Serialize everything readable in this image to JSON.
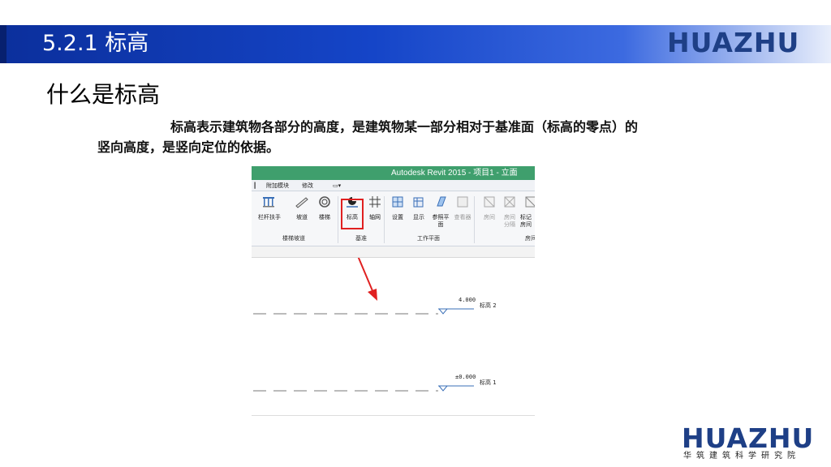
{
  "header": {
    "title": "5.2.1  标高",
    "logo": "HUAZHU"
  },
  "content": {
    "heading": "什么是标高",
    "paragraph": "标高表示建筑物各部分的高度，是建筑物某一部分相对于基准面（标高的零点）的竖向高度，是竖向定位的依据。"
  },
  "revit": {
    "window_title": "Autodesk Revit 2015 -   项目1 - 立面",
    "tabs": [
      "附加模块",
      "修改"
    ],
    "tools": [
      {
        "label": "栏杆扶手",
        "icon": "railing-icon",
        "dim": false
      },
      {
        "label": "坡道",
        "icon": "ramp-icon",
        "dim": false
      },
      {
        "label": "楼梯",
        "icon": "stair-icon",
        "dim": false
      },
      {
        "label": "标高",
        "icon": "level-icon",
        "dim": false
      },
      {
        "label": "轴网",
        "icon": "grid-icon",
        "dim": false
      },
      {
        "label": "设置",
        "icon": "workplane-set-icon",
        "dim": false
      },
      {
        "label": "显示",
        "icon": "workplane-show-icon",
        "dim": false
      },
      {
        "label": "参照平面",
        "icon": "ref-plane-icon",
        "dim": false
      },
      {
        "label": "查看器",
        "icon": "viewer-icon",
        "dim": true
      },
      {
        "label": "房间",
        "icon": "room-icon",
        "dim": true
      },
      {
        "label": "房间分隔",
        "icon": "room-separator-icon",
        "dim": true
      },
      {
        "label": "标记房间",
        "icon": "tag-room-icon",
        "dim": true
      }
    ],
    "groups": [
      "楼梯坡道",
      "基准",
      "工作平面",
      "房间"
    ],
    "levels": [
      {
        "elevation": "4.000",
        "name": "标高 2"
      },
      {
        "elevation": "±0.000",
        "name": "标高 1"
      }
    ],
    "colors": {
      "title_bar": "#3f9f6d",
      "highlight": "#e02020",
      "arrow": "#e02020"
    }
  },
  "footer": {
    "logo": "HUAZHU",
    "subtitle": "华筑建筑科学研究院"
  }
}
